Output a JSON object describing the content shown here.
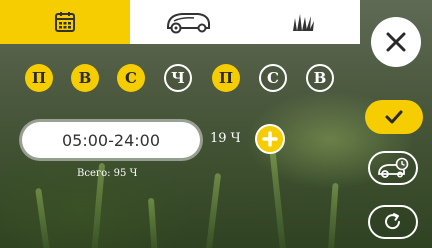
{
  "tabs": [
    {
      "icon": "calendar-icon",
      "active": true
    },
    {
      "icon": "robot-mower-icon",
      "active": false
    },
    {
      "icon": "grass-icon",
      "active": false
    }
  ],
  "days": [
    {
      "label": "П",
      "active": true
    },
    {
      "label": "В",
      "active": true
    },
    {
      "label": "С",
      "active": true
    },
    {
      "label": "Ч",
      "active": false
    },
    {
      "label": "П",
      "active": true
    },
    {
      "label": "С",
      "active": false
    },
    {
      "label": "В",
      "active": false
    }
  ],
  "schedule": {
    "start": "05:00",
    "separator": "-",
    "end": "24:00",
    "duration": "19 Ч",
    "total": "Всего: 95 Ч"
  },
  "side_buttons": [
    "check-icon",
    "mower-schedule-icon",
    "refresh-icon"
  ],
  "colors": {
    "accent": "#f5cd00",
    "tab_bar": "#ffffff",
    "text_dark": "#2a2a2a"
  }
}
